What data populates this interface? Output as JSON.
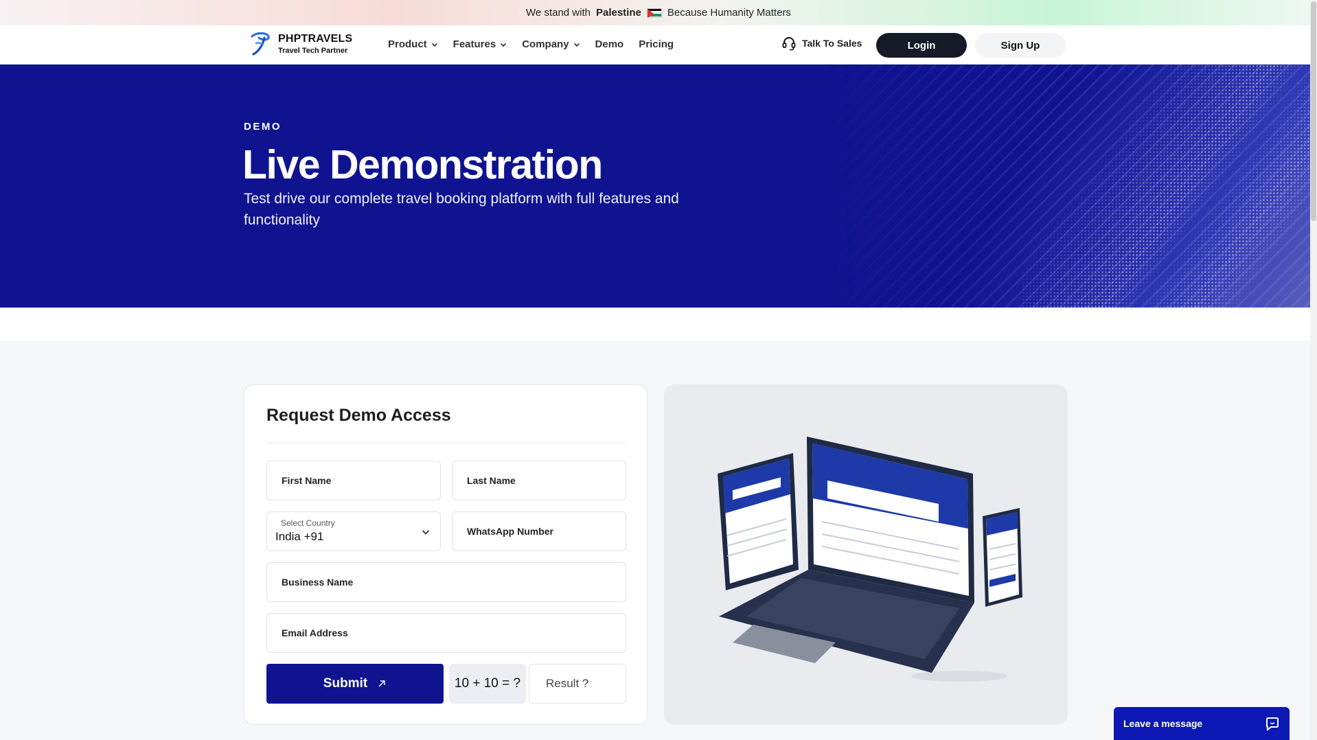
{
  "banner": {
    "prefix": "We stand with",
    "highlight": "Palestine",
    "suffix": "Because Humanity Matters"
  },
  "header": {
    "logo_title": "PHPTRAVELS",
    "logo_subtitle": "Travel Tech Partner",
    "nav": [
      {
        "label": "Product",
        "dropdown": true
      },
      {
        "label": "Features",
        "dropdown": true
      },
      {
        "label": "Company",
        "dropdown": true
      },
      {
        "label": "Demo",
        "dropdown": false
      },
      {
        "label": "Pricing",
        "dropdown": false
      }
    ],
    "talk_to_sales": "Talk To Sales",
    "login": "Login",
    "signup": "Sign Up"
  },
  "hero": {
    "kicker": "DEMO",
    "title": "Live Demonstration",
    "description": "Test drive our complete travel booking platform with full features and functionality"
  },
  "form": {
    "title": "Request Demo Access",
    "first_name_placeholder": "First Name",
    "last_name_placeholder": "Last Name",
    "country_label": "Select Country",
    "country_value": "India +91",
    "whatsapp_placeholder": "WhatsApp Number",
    "business_placeholder": "Business Name",
    "email_placeholder": "Email Address",
    "submit_label": "Submit",
    "captcha_question": "10 + 10 = ?",
    "captcha_placeholder": "Result ?"
  },
  "chat": {
    "label": "Leave a message"
  },
  "colors": {
    "brand_blue": "#10138f",
    "chat_blue": "#0d18b5",
    "dark_button": "#151a26"
  }
}
